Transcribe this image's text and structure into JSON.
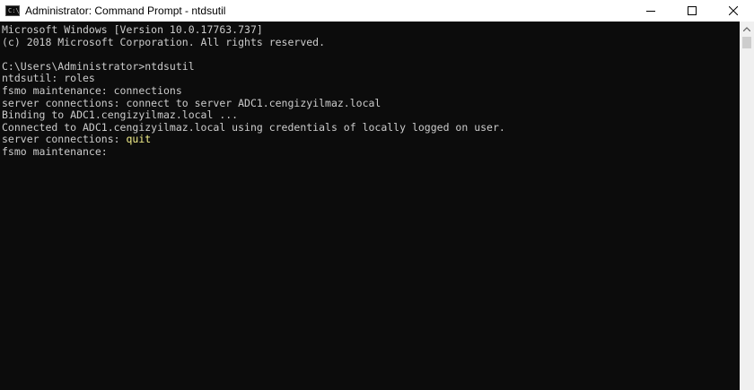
{
  "window": {
    "title": "Administrator: Command Prompt - ntdsutil",
    "app_icon_glyph": "C:\\",
    "controls": {
      "minimize_icon": "minimize-icon",
      "maximize_icon": "maximize-icon",
      "close_icon": "close-icon"
    }
  },
  "console": {
    "lines": [
      {
        "prefix": "Microsoft Windows [Version 10.0.17763.737]",
        "typed": ""
      },
      {
        "prefix": "(c) 2018 Microsoft Corporation. All rights reserved.",
        "typed": ""
      },
      {
        "prefix": "",
        "typed": ""
      },
      {
        "prefix": "C:\\Users\\Administrator>ntdsutil",
        "typed": ""
      },
      {
        "prefix": "ntdsutil: roles",
        "typed": ""
      },
      {
        "prefix": "fsmo maintenance: connections",
        "typed": ""
      },
      {
        "prefix": "server connections: connect to server ADC1.cengizyilmaz.local",
        "typed": ""
      },
      {
        "prefix": "Binding to ADC1.cengizyilmaz.local ...",
        "typed": ""
      },
      {
        "prefix": "Connected to ADC1.cengizyilmaz.local using credentials of locally logged on user.",
        "typed": ""
      },
      {
        "prefix": "server connections: ",
        "typed": "quit"
      },
      {
        "prefix": "fsmo maintenance:",
        "typed": ""
      }
    ]
  },
  "colors": {
    "console_bg": "#0c0c0c",
    "console_text": "#cccccc",
    "typed_highlight": "#f3ef8a",
    "titlebar_bg": "#ffffff"
  }
}
